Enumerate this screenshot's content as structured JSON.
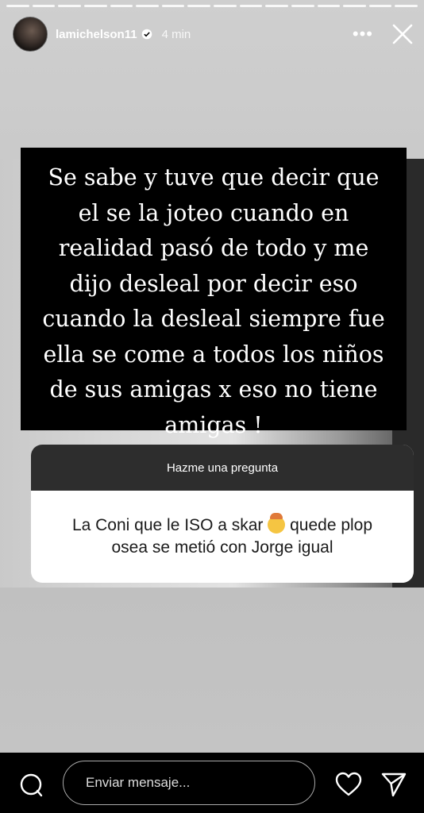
{
  "header": {
    "username": "lamichelson11",
    "time": "4 min",
    "more_label": "•••"
  },
  "story": {
    "text_lines": [
      "Se sabe y tuve que decir que",
      "el se la joteo cuando en",
      "realidad pasó de todo y me",
      "dijo desleal por decir eso",
      "cuando la desleal siempre fue",
      "ella se come a todos los niños",
      "de sus amigas x eso no tiene",
      "amigas !"
    ],
    "question_sticker": {
      "title": "Hazme una pregunta",
      "answer_line1_before_emoji": "La Coni que le ISO a skar",
      "answer_line1_after_emoji": "quede plop",
      "answer_line2": "osea se metió con Jorge igual",
      "emoji": "exploding-head-emoji"
    }
  },
  "footer": {
    "message_placeholder": "Enviar mensaje..."
  },
  "colors": {
    "text_bg": "#000000",
    "sticker_header": "#2d2d2d",
    "sticker_body": "#ffffff"
  }
}
